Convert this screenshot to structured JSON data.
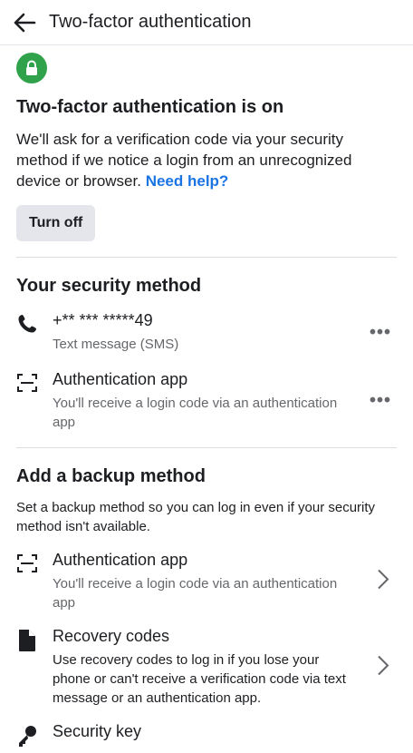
{
  "header": {
    "title": "Two-factor authentication"
  },
  "status": {
    "title": "Two-factor authentication is on",
    "description": "We'll ask for a verification code via your security method if we notice a login from an unrecognized device or browser.",
    "help_link": "Need help?",
    "turn_off_label": "Turn off"
  },
  "security_method": {
    "title": "Your security method",
    "items": [
      {
        "icon": "phone-icon",
        "title": "+** *** *****49",
        "subtitle": "Text message (SMS)",
        "action": "more"
      },
      {
        "icon": "qr-scan-icon",
        "title": "Authentication app",
        "subtitle": "You'll receive a login code via an authentication app",
        "action": "more"
      }
    ]
  },
  "backup": {
    "title": "Add a backup method",
    "description": "Set a backup method so you can log in even if your security method isn't available.",
    "items": [
      {
        "icon": "qr-scan-icon",
        "title": "Authentication app",
        "subtitle": "You'll receive a login code via an authentication app"
      },
      {
        "icon": "document-icon",
        "title": "Recovery codes",
        "subtitle": "Use recovery codes to log in if you lose your phone or can't receive a verification code via text message or an authentication app."
      },
      {
        "icon": "key-icon",
        "title": "Security key",
        "subtitle": ""
      }
    ]
  },
  "colors": {
    "accent": "#1b74e4",
    "success": "#31a24c",
    "secondary_text": "#65676b",
    "button_bg": "#e4e6eb"
  }
}
